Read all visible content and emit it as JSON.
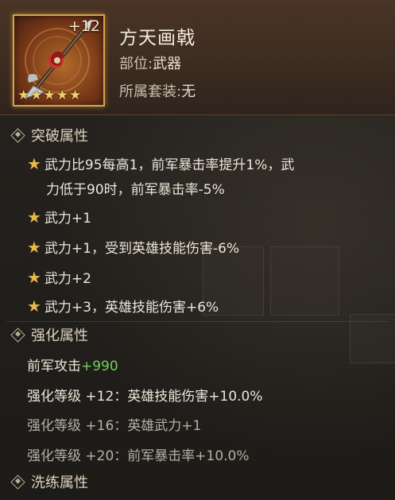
{
  "item": {
    "level_badge": "+12",
    "star_count": 5,
    "name": "方天画戟",
    "slot_label": "部位:",
    "slot_value": "武器",
    "set_label": "所属套装:",
    "set_value": "无"
  },
  "breakthrough": {
    "header": "突破属性",
    "lines": [
      "武力比95每高1，前军暴击率提升1%，武",
      "力低于90时，前军暴击率-5%",
      "武力+1",
      "武力+1，受到英雄技能伤害-6%",
      "武力+2",
      "武力+3，英雄技能伤害+6%"
    ]
  },
  "enhance": {
    "header": "强化属性",
    "attack_label": "前军攻击",
    "attack_value": "+990",
    "levels": [
      "强化等级 +12：英雄技能伤害+10.0%",
      "强化等级 +16：英雄武力+1",
      "强化等级 +20：前军暴击率+10.0%"
    ]
  },
  "refine": {
    "header": "洗练属性"
  },
  "colors": {
    "gold_star": "#e8b84a",
    "bonus_green": "#6fcf5a",
    "frame_gold": "#d7a24a"
  }
}
